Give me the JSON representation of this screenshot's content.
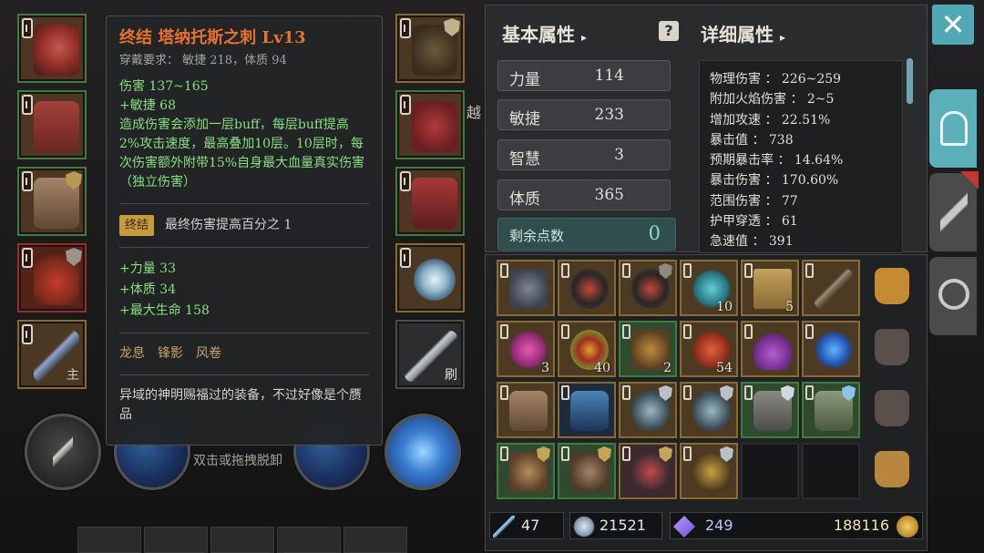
{
  "tooltip": {
    "title": "终结  塔纳托斯之刺  Lv13",
    "requirement": "穿戴要求：  敏捷 218，体质 94",
    "stats": [
      "伤害  137~165",
      "+敏捷  68",
      "造成伤害会添加一层buff，每层buff提高2%攻击速度，最高叠加10层。10层时，每次伤害额外附带15%自身最大血量真实伤害（独立伤害）"
    ],
    "set_badge": "终结",
    "set_effect": "最终伤害提高百分之 1",
    "bonus": [
      "+力量  33",
      "+体质  34",
      "+最大生命  158"
    ],
    "affixes": [
      "龙息",
      "锋影",
      "风卷"
    ],
    "description": "异域的神明赐福过的装备，不过好像是个赝品"
  },
  "equipment": {
    "main_tag": "主",
    "brush_tag": "刷"
  },
  "skills": {
    "drag_hint": "双击或拖拽脱卸"
  },
  "attributes": {
    "basic_header": "基本属性",
    "detail_header": "详细属性",
    "help_icon": "?",
    "basic": [
      {
        "label": "力量",
        "value": "114"
      },
      {
        "label": "敏捷",
        "value": "233"
      },
      {
        "label": "智慧",
        "value": "3"
      },
      {
        "label": "体质",
        "value": "365"
      }
    ],
    "points_label": "剩余点数",
    "points_value": "0",
    "details": [
      "物理伤害 ： 226~259",
      "附加火焰伤害 ： 2~5",
      "增加攻速 ： 22.51%",
      "暴击值 ： 738",
      "预期暴击率 ： 14.64%",
      "暴击伤害 ： 170.60%",
      "范围伤害 ： 77",
      "护甲穿透 ： 61",
      "急速值 ： 391"
    ]
  },
  "inventory": {
    "counts": {
      "r0c4": "10",
      "r0c5": "5",
      "r1c0": "3",
      "r1c1": "40",
      "r1c2": "2",
      "r1c3": "54"
    },
    "currency": {
      "wands": "47",
      "crystal": "21521",
      "gem": "249",
      "gold": "188116"
    }
  },
  "side_partial_text": "越",
  "colors": {
    "accent_teal": "#4fa8b3",
    "rare_gold_border": "#8a6a33",
    "green_border": "#3f7d3e",
    "title_orange": "#e7722f",
    "stat_green": "#88e07f"
  }
}
